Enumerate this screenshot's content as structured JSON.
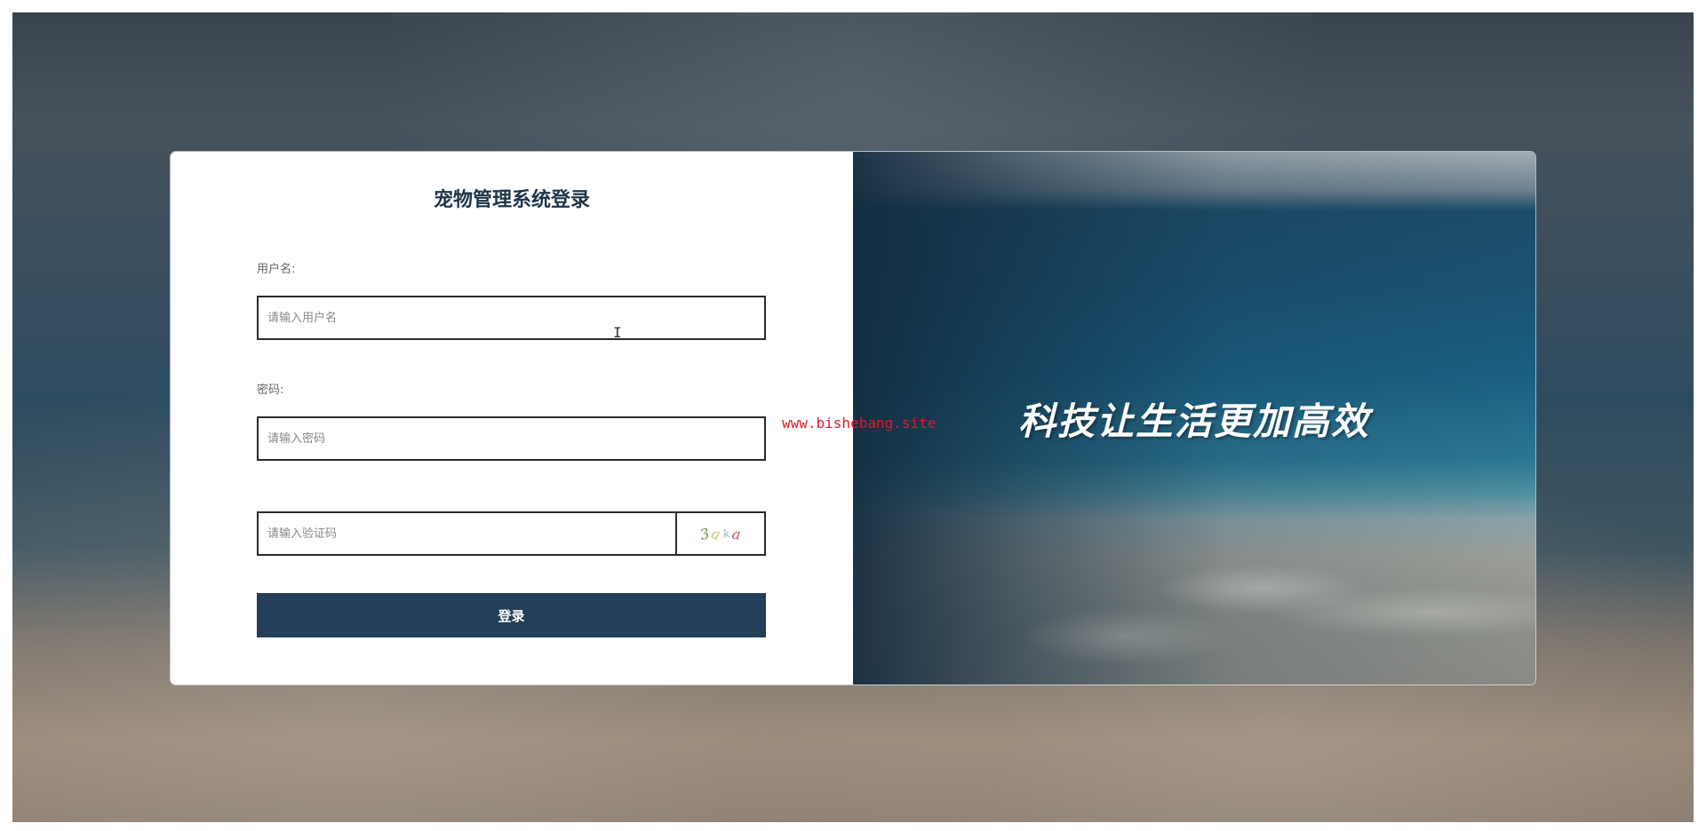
{
  "login": {
    "title": "宠物管理系统登录",
    "username_label": "用户名:",
    "username_placeholder": "请输入用户名",
    "password_label": "密码:",
    "password_placeholder": "请输入密码",
    "captcha_placeholder": "请输入验证码",
    "captcha_chars": [
      "3",
      "a",
      "k",
      "a"
    ],
    "submit_label": "登录"
  },
  "banner": {
    "slogan": "科技让生活更加高效"
  },
  "watermark": "www.bishebang.site",
  "colors": {
    "primary": "#233e56",
    "title": "#1f3448",
    "watermark": "#e0182a"
  }
}
